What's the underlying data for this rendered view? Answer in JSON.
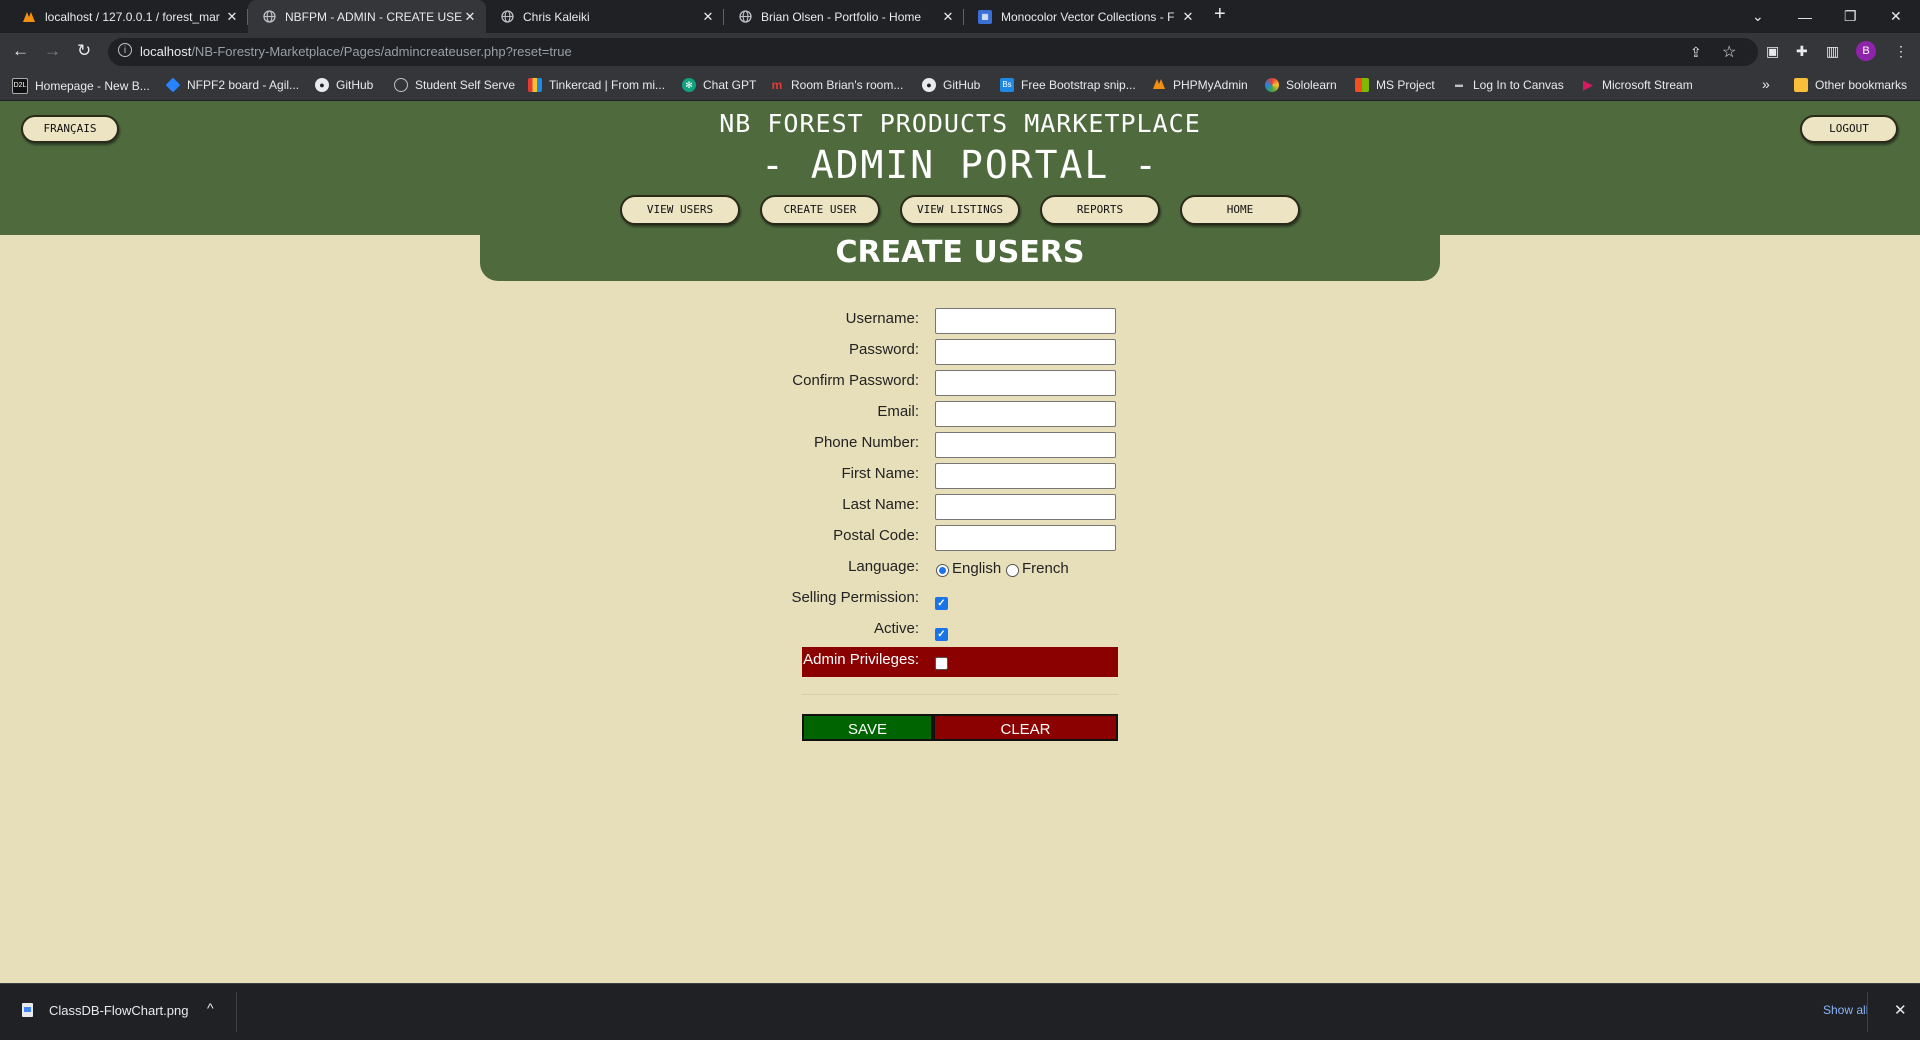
{
  "browser": {
    "tabs": [
      {
        "title": "localhost / 127.0.0.1 / forest_mar",
        "icon": "phpmyadmin-icon"
      },
      {
        "title": "NBFPM - ADMIN - CREATE USER",
        "icon": "globe-icon"
      },
      {
        "title": "Chris Kaleiki",
        "icon": "globe-icon"
      },
      {
        "title": "Brian Olsen - Portfolio - Home",
        "icon": "globe-icon"
      },
      {
        "title": "Monocolor Vector Collections - F",
        "icon": "vector-collection-icon"
      }
    ],
    "url_host": "localhost",
    "url_path": "/NB-Forestry-Marketplace/Pages/admincreateuser.php?reset=true",
    "profile_initial": "B",
    "bookmarks": [
      "Homepage - New B...",
      "NFPF2 board - Agil...",
      "GitHub",
      "Student Self Serve",
      "Tinkercad | From mi...",
      "Chat GPT",
      "Room Brian's room...",
      "GitHub",
      "Free Bootstrap snip...",
      "PHPMyAdmin",
      "Sololearn",
      "MS Project",
      "Log In to Canvas",
      "Microsoft Stream"
    ],
    "other_bookmarks": "Other bookmarks"
  },
  "header": {
    "lang_button": "FRANÇAIS",
    "logout_button": "LOGOUT",
    "site_title": "NB FOREST PRODUCTS MARKETPLACE",
    "portal_title": "- ADMIN PORTAL -",
    "nav": [
      "VIEW USERS",
      "CREATE USER",
      "VIEW LISTINGS",
      "REPORTS",
      "HOME"
    ]
  },
  "page_heading": "CREATE USERS",
  "form": {
    "fields": [
      {
        "label": "Username:",
        "value": ""
      },
      {
        "label": "Password:",
        "value": ""
      },
      {
        "label": "Confirm Password:",
        "value": ""
      },
      {
        "label": "Email:",
        "value": ""
      },
      {
        "label": "Phone Number:",
        "value": ""
      },
      {
        "label": "First Name:",
        "value": ""
      },
      {
        "label": "Last Name:",
        "value": ""
      },
      {
        "label": "Postal Code:",
        "value": ""
      }
    ],
    "language_label": "Language:",
    "language_options": [
      "English",
      "French"
    ],
    "language_selected": "English",
    "selling_label": "Selling Permission:",
    "selling_checked": true,
    "active_label": "Active:",
    "active_checked": true,
    "admin_label": "Admin Privileges:",
    "admin_checked": false,
    "save_button": "SAVE",
    "clear_button": "CLEAR"
  },
  "downloads": {
    "file": "ClassDB-FlowChart.png",
    "show_all": "Show all"
  },
  "colors": {
    "header_green": "#4f6b3e",
    "page_bg": "#e7dfba",
    "save_green": "#006400",
    "danger_red": "#8b0000"
  }
}
